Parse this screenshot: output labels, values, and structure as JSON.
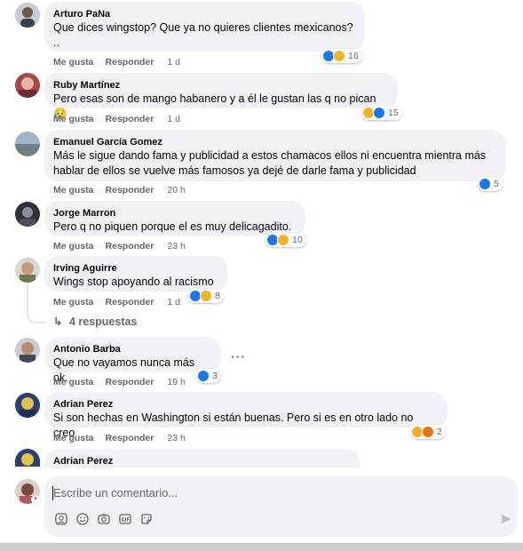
{
  "comments": [
    {
      "name": "Arturo PaNa",
      "text": "Que dices wingstop? Que ya no quieres clientes mexicanos?",
      "text2": "..",
      "like": "Me gusta",
      "reply": "Responder",
      "time": "1 d",
      "count": "16"
    },
    {
      "name": "Ruby Martínez",
      "text": "Pero esas son de mango habanero y a él le gustan las q no pican 😥",
      "like": "Me gusta",
      "reply": "Responder",
      "time": "1 d",
      "count": "15"
    },
    {
      "name": "Emanuel García Gomez",
      "text": "Más le sigue dando fama y publicidad a estos chamacos ellos ni encuentra mientra más",
      "text2": "hablar de ellos se vuelve más famosos ya dejé de darle fama y publicidad",
      "like": "Me gusta",
      "reply": "Responder",
      "time": "20 h",
      "count": "5"
    },
    {
      "name": "Jorge Marron",
      "text": "Pero q no piquen porque el es muy delicagadito.",
      "like": "Me gusta",
      "reply": "Responder",
      "time": "23 h",
      "count": "10"
    },
    {
      "name": "Irving Aguirre",
      "text": "Wings stop apoyando al racismo",
      "like": "Me gusta",
      "reply": "Responder",
      "time": "1 d",
      "count": "8",
      "replies": "4 respuestas"
    },
    {
      "name": "Antonio Barba",
      "text": "Que no vayamos nunca más ok.",
      "like": "Me gusta",
      "reply": "Responder",
      "time": "19 h",
      "count": "3"
    },
    {
      "name": "Adrian Perez",
      "text": "Si son hechas en Washington si están buenas. Pero si es en otro lado no creo",
      "like": "Me gusta",
      "reply": "Responder",
      "time": "23 h",
      "count": "2"
    },
    {
      "name": "Adrian Perez"
    }
  ],
  "composer": {
    "placeholder": "Escribe un comentario..."
  },
  "more_options": "···",
  "colors": {
    "like": "#1877f2",
    "haha": "#f7b125",
    "angry": "#e9710f",
    "bubble": "#f0f2f5",
    "meta": "#65676b"
  }
}
